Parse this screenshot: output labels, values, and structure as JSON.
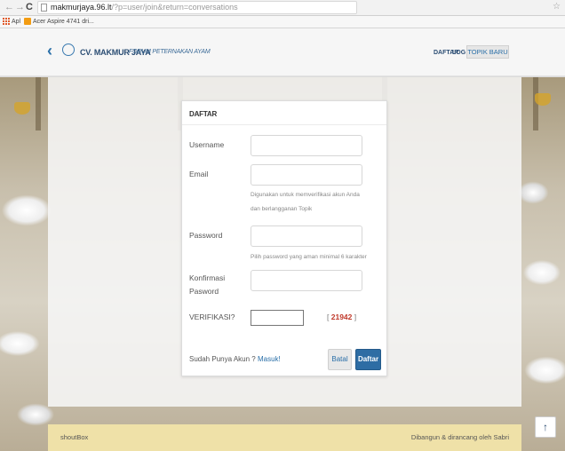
{
  "browser": {
    "url_host": "makmurjaya.96.lt",
    "url_path": "/?p=user/join&return=conversations",
    "bookmarks": [
      "Apl",
      "Acer Aspire 4741 dri..."
    ]
  },
  "header": {
    "brand": "CV. MAKMUR JAYA",
    "tagline": "FORUM PETERNAKAN AYAM",
    "nav_daftar": "DAFTAR",
    "nav_login": "LOG IN",
    "nav_topik": "TOPIK BARU"
  },
  "form": {
    "title": "DAFTAR",
    "username_label": "Username",
    "email_label": "Email",
    "email_help": "Digunakan untuk memverifikasi akun Anda dan berlangganan Topik",
    "password_label": "Password",
    "password_help": "Pilih password yang aman minimal 6 karakter",
    "confirm_label": "Konfirmasi Pasword",
    "captcha_label": "VERIFIKASI?",
    "captcha_code": "21942",
    "login_prompt": "Sudah Punya Akun ?",
    "login_link": "Masuk!",
    "cancel_label": "Batal",
    "submit_label": "Daftar"
  },
  "footer": {
    "left": "shoutBox",
    "right": "Dibangun & dirancang oleh Sabri"
  },
  "scroll_top_icon": "arrow-up-icon",
  "accent": "#2e6da4"
}
